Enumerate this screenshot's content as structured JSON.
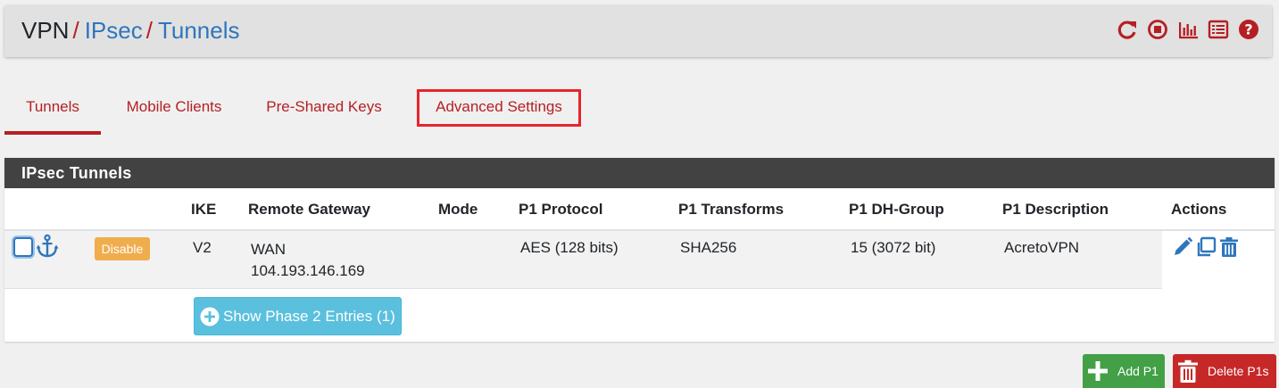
{
  "breadcrumb": {
    "root": "VPN",
    "sep": "/",
    "level2": "IPsec",
    "level3": "Tunnels"
  },
  "header_icons": [
    "reload-icon",
    "stop-circle-icon",
    "bar-chart-icon",
    "list-icon",
    "help-icon"
  ],
  "tabs": [
    {
      "label": "Tunnels",
      "active": true
    },
    {
      "label": "Mobile Clients",
      "active": false
    },
    {
      "label": "Pre-Shared Keys",
      "active": false
    },
    {
      "label": "Advanced Settings",
      "active": false,
      "highlighted": true
    }
  ],
  "panel": {
    "title": "IPsec Tunnels",
    "columns": [
      "IKE",
      "Remote Gateway",
      "Mode",
      "P1 Protocol",
      "P1 Transforms",
      "P1 DH-Group",
      "P1 Description",
      "Actions"
    ],
    "rows": [
      {
        "toggle": "Disable",
        "ike": "V2",
        "gateway_iface": "WAN",
        "gateway_ip": "104.193.146.169",
        "mode": "",
        "protocol": "AES (128 bits)",
        "transforms": "SHA256",
        "dh_group": "15 (3072 bit)",
        "description": "AcretoVPN"
      }
    ],
    "phase2_button": "Show Phase 2 Entries (1)"
  },
  "footer": {
    "add_label": "Add P1",
    "delete_label": "Delete P1s"
  },
  "colors": {
    "brand_red": "#b51f24",
    "link_blue": "#2f76bc",
    "highlight_red": "#e8242b",
    "heading_dark": "#424242",
    "info": "#5bc0de",
    "warning": "#f0ad4e",
    "success": "#43a047",
    "danger": "#c62828"
  }
}
